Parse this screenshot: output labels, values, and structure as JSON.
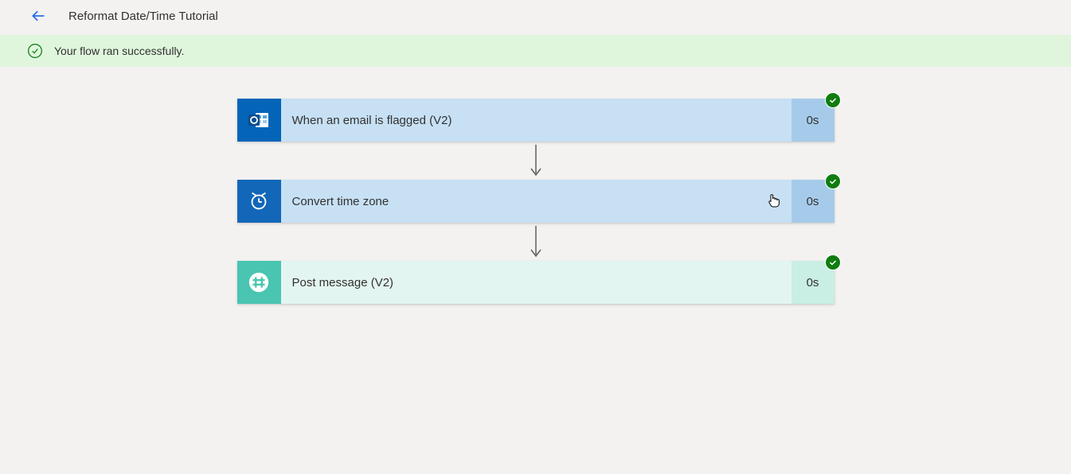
{
  "header": {
    "title": "Reformat Date/Time Tutorial"
  },
  "banner": {
    "message": "Your flow ran successfully."
  },
  "steps": [
    {
      "label": "When an email is flagged (V2)",
      "duration": "0s",
      "kind": "outlook"
    },
    {
      "label": "Convert time zone",
      "duration": "0s",
      "kind": "clock"
    },
    {
      "label": "Post message (V2)",
      "duration": "0s",
      "kind": "slack"
    }
  ]
}
